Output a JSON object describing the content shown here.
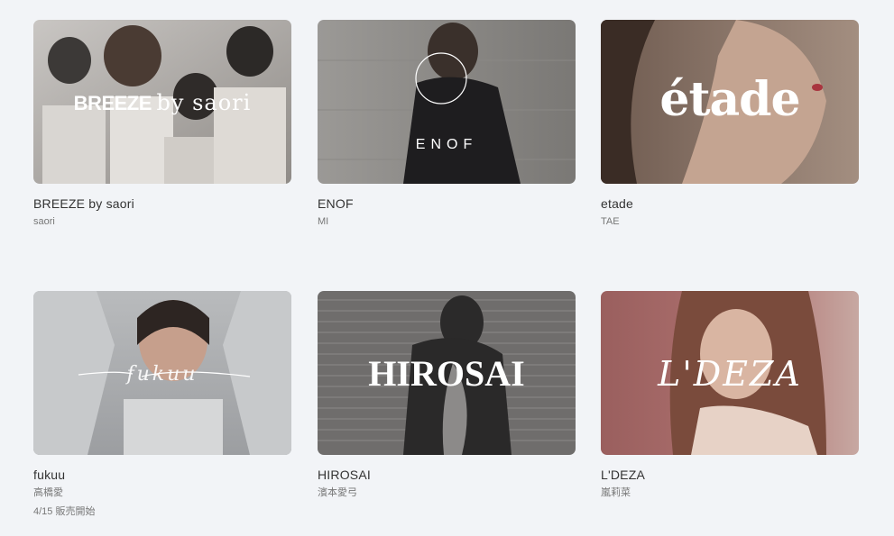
{
  "brands": [
    {
      "name": "BREEZE by saori",
      "designer": "saori",
      "logo_main": "BREEZE",
      "logo_sub": "by saori",
      "bg_color": "#a7a3a0"
    },
    {
      "name": "ENOF",
      "designer": "MI",
      "logo_main": "ENOF",
      "bg_color": "#8e8c8a"
    },
    {
      "name": "etade",
      "designer": "TAE",
      "logo_main": "étade",
      "bg_color": "#8a7669"
    },
    {
      "name": "fukuu",
      "designer": "高橋愛",
      "sale_note": "4/15 販売開始",
      "logo_main": "fukuu",
      "bg_color": "#a9abad"
    },
    {
      "name": "HIROSAI",
      "designer": "濱本愛弓",
      "logo_main": "HIROSAI",
      "bg_color": "#6d6b6a"
    },
    {
      "name": "L'DEZA",
      "designer": "嵐莉菜",
      "logo_main": "L'DEZA",
      "bg_color": "#a66c6a"
    }
  ]
}
